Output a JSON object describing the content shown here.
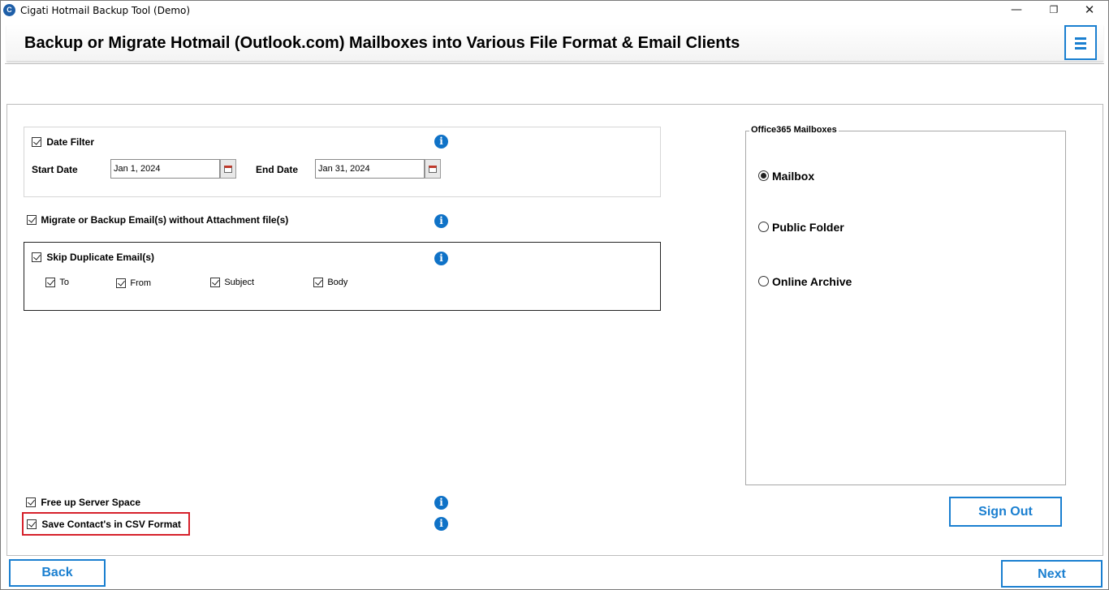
{
  "window": {
    "title": "Cigati Hotmail Backup Tool (Demo)",
    "app_icon_letter": "C",
    "controls": {
      "minimize": "—",
      "maximize": "❐",
      "close": "✕"
    }
  },
  "header": {
    "title": "Backup or Migrate Hotmail (Outlook.com) Mailboxes into Various File Format & Email Clients",
    "menu_icon": "hamburger-menu-icon"
  },
  "options": {
    "date_filter": {
      "label": "Date Filter",
      "checked": true,
      "start_label": "Start Date",
      "start_value": "Jan 1, 2024",
      "end_label": "End Date",
      "end_value": "Jan 31, 2024"
    },
    "without_attachment": {
      "label": "Migrate or Backup Email(s) without Attachment file(s)",
      "checked": true
    },
    "skip_duplicate": {
      "label": "Skip Duplicate Email(s)",
      "checked": true,
      "fields": [
        {
          "label": "To",
          "checked": true
        },
        {
          "label": "From",
          "checked": true
        },
        {
          "label": "Subject",
          "checked": true
        },
        {
          "label": "Body",
          "checked": true
        }
      ]
    },
    "free_up_space": {
      "label": "Free up Server Space",
      "checked": true
    },
    "save_contacts_csv": {
      "label": "Save Contact's in CSV Format",
      "checked": true
    }
  },
  "info_icon_glyph": "i",
  "office365": {
    "legend": "Office365 Mailboxes",
    "choices": [
      {
        "label": "Mailbox",
        "selected": true
      },
      {
        "label": "Public Folder",
        "selected": false
      },
      {
        "label": "Online Archive",
        "selected": false
      }
    ]
  },
  "buttons": {
    "sign_out": "Sign Out",
    "back": "Back",
    "next": "Next"
  },
  "colors": {
    "accent_blue": "#1a7fd0",
    "info_blue": "#0f72c7",
    "highlight_red": "#d6212b"
  }
}
